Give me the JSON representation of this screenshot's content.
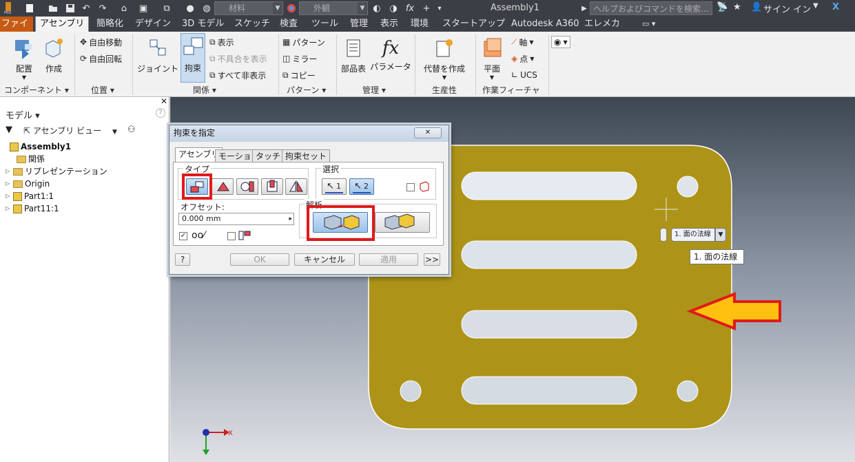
{
  "app": {
    "title": "Assembly1",
    "help_placeholder": "ヘルプおよびコマンドを検索...",
    "sign_in": "サイン イン",
    "material_value": "材料",
    "appearance_value": "外観"
  },
  "menu": {
    "file": "ファイル",
    "tabs": [
      "アセンブリ",
      "簡略化",
      "デザイン",
      "3D モデル",
      "スケッチ",
      "検査",
      "ツール",
      "管理",
      "表示",
      "環境",
      "スタートアップ",
      "Autodesk A360",
      "エレメカ"
    ]
  },
  "ribbon": {
    "place": "配置",
    "create": "作成",
    "free_move": "自由移動",
    "free_rotate": "自由回転",
    "joint": "ジョイント",
    "constrain": "拘束",
    "show": "表示",
    "show_sick": "不具合を表示",
    "hide_all": "すべて非表示",
    "pattern": "パターン",
    "mirror": "ミラー",
    "copy": "コピー",
    "bom": "部品表",
    "parameters": "パラメータ",
    "substitute": "代替を作成",
    "plane": "平面",
    "axis": "軸",
    "point": "点",
    "ucs": "UCS",
    "panels": {
      "component": "コンポーネント",
      "position": "位置",
      "relationships": "関係",
      "pattern": "パターン",
      "manage": "管理",
      "productivity": "生産性",
      "work_features": "作業フィーチャ"
    }
  },
  "browser": {
    "title": "モデル",
    "view": "アセンブリ ビュー",
    "items": [
      "Assembly1",
      "関係",
      "リプレゼンテーション",
      "Origin",
      "Part1:1",
      "Part11:1"
    ]
  },
  "dialog": {
    "title": "拘束を指定",
    "tabs": [
      "アセンブリ",
      "モーション",
      "タッチ",
      "拘束セット"
    ],
    "type_label": "タイプ",
    "select_label": "選択",
    "offset_label": "オフセット:",
    "offset_value": "0.000 mm",
    "solution_label": "解析",
    "ok": "OK",
    "cancel": "キャンセル",
    "apply": "適用",
    "more": ">>",
    "help": "?",
    "sel1": "1",
    "sel2": "2"
  },
  "viewport": {
    "chip_label": "1. 面の法線",
    "tooltip": "1. 面の法線",
    "axis_x": "X",
    "part_color": "#ad9418",
    "arrow_color": "#ffc010",
    "highlight_color": "#e01a1a"
  }
}
